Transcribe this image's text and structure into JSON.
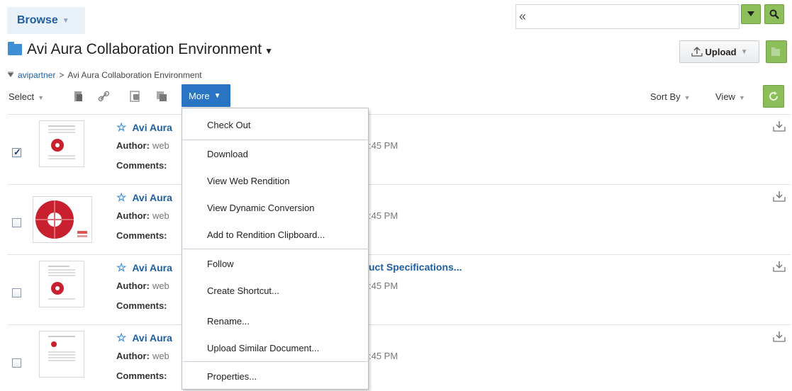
{
  "header": {
    "browse_label": "Browse",
    "collapse_glyph": "«",
    "search_value": ""
  },
  "title": {
    "text": "Avi Aura Collaboration Environment"
  },
  "breadcrumb": {
    "root": "avipartner",
    "separator": ">",
    "current": "Avi Aura Collaboration Environment"
  },
  "actions": {
    "upload_label": "Upload",
    "select_label": "Select",
    "more_label": "More",
    "sort_label": "Sort By",
    "view_label": "View"
  },
  "rows": [
    {
      "title": "Avi Aura",
      "title_suffix": "",
      "author_label": "Author:",
      "author": "web",
      "time": ":45 PM",
      "comments_label": "Comments:",
      "checked": true
    },
    {
      "title": "Avi Aura",
      "title_suffix": "",
      "author_label": "Author:",
      "author": "web",
      "time": ":45 PM",
      "comments_label": "Comments:",
      "checked": false
    },
    {
      "title": "Avi Aura",
      "title_suffix": "uct Specifications...",
      "author_label": "Author:",
      "author": "web",
      "time": ":45 PM",
      "comments_label": "Comments:",
      "checked": false
    },
    {
      "title": "Avi Aura",
      "title_suffix": "",
      "author_label": "Author:",
      "author": "web",
      "time": ":45 PM",
      "comments_label": "Comments:",
      "checked": false
    }
  ],
  "menu": {
    "items": [
      "Check Out",
      "Download",
      "View Web Rendition",
      "View Dynamic Conversion",
      "Add to Rendition Clipboard...",
      "Follow",
      "Create Shortcut...",
      "Rename...",
      "Upload Similar Document...",
      "Properties..."
    ]
  },
  "colors": {
    "accent": "#2a74c4",
    "link": "#1f5fa0",
    "green": "#8cbf5a"
  }
}
